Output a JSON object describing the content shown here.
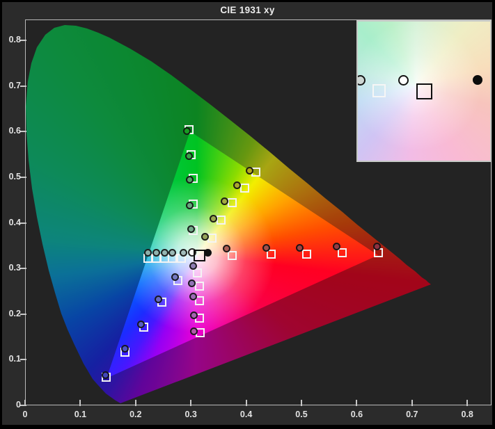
{
  "window": {
    "title": "CIE 1931 xy"
  },
  "chart_data": {
    "type": "scatter",
    "title": "CIE 1931 xy",
    "description": "CIE 1931 chromaticity horseshoe with Rec.709 gamut triangle, saturation sweep targets (white squares) and measurements (circles)",
    "xlim": [
      0,
      0.844
    ],
    "ylim": [
      0,
      0.846
    ],
    "grid": false,
    "x_ticks": [
      0,
      0.1,
      0.2,
      0.3,
      0.4,
      0.5,
      0.6,
      0.7,
      0.8
    ],
    "x_tick_labels": [
      "0",
      "0.1",
      "0.2",
      "0.3",
      "0.4",
      "0.5",
      "0.6",
      "0.7",
      "0.8"
    ],
    "y_ticks": [
      0,
      0.1,
      0.2,
      0.3,
      0.4,
      0.5,
      0.6,
      0.7,
      0.8
    ],
    "y_tick_labels": [
      "0",
      "0.1",
      "0.2",
      "0.3",
      "0.4",
      "0.5",
      "0.6",
      "0.7",
      "0.8"
    ],
    "gamut_triangle": {
      "name": "Rec. 709",
      "red": [
        0.64,
        0.33
      ],
      "green": [
        0.3,
        0.6
      ],
      "blue": [
        0.15,
        0.06
      ]
    },
    "white_point": {
      "target": [
        0.315,
        0.329
      ],
      "measured": [
        0.302,
        0.335
      ],
      "measured_fill": "#ffffff",
      "reference_dot": [
        0.331,
        0.335
      ],
      "reference_dot_fill": "#101010"
    },
    "series": [
      {
        "name": "red-saturation-sweep",
        "targets": [
          [
            0.375,
            0.329
          ],
          [
            0.445,
            0.331
          ],
          [
            0.509,
            0.331
          ],
          [
            0.574,
            0.335
          ],
          [
            0.639,
            0.335
          ]
        ],
        "measurements": [
          [
            0.365,
            0.343
          ],
          [
            0.436,
            0.346
          ],
          [
            0.497,
            0.346
          ],
          [
            0.564,
            0.348
          ],
          [
            0.637,
            0.348
          ]
        ],
        "measurement_fills": [
          "#ad5e55",
          "#a44f4b",
          "#9c4345",
          "#953a42",
          "#8f3140"
        ]
      },
      {
        "name": "green-saturation-sweep",
        "targets": [
          [
            0.304,
            0.384
          ],
          [
            0.304,
            0.442
          ],
          [
            0.304,
            0.497
          ],
          [
            0.301,
            0.55
          ],
          [
            0.297,
            0.605
          ]
        ],
        "measurements": [
          [
            0.3,
            0.387
          ],
          [
            0.298,
            0.439
          ],
          [
            0.298,
            0.494
          ],
          [
            0.296,
            0.547
          ],
          [
            0.293,
            0.602
          ]
        ],
        "measurement_fills": [
          "#74aa8a",
          "#65a87c",
          "#53a566",
          "#38a146",
          "#189c22"
        ]
      },
      {
        "name": "blue-saturation-sweep",
        "targets": [
          [
            0.276,
            0.273
          ],
          [
            0.247,
            0.227
          ],
          [
            0.215,
            0.172
          ],
          [
            0.181,
            0.117
          ],
          [
            0.147,
            0.061
          ]
        ],
        "measurements": [
          [
            0.271,
            0.282
          ],
          [
            0.241,
            0.232
          ],
          [
            0.21,
            0.178
          ],
          [
            0.181,
            0.125
          ],
          [
            0.146,
            0.067
          ]
        ],
        "measurement_fills": [
          "#7478c2",
          "#6668c4",
          "#585cc6",
          "#4e52c4",
          "#4347bb"
        ]
      },
      {
        "name": "cyan-saturation-sweep",
        "targets": [
          [
            0.222,
            0.322
          ],
          [
            0.237,
            0.322
          ],
          [
            0.252,
            0.322
          ],
          [
            0.267,
            0.322
          ],
          [
            0.283,
            0.322
          ]
        ],
        "measurements": [
          [
            0.222,
            0.335
          ],
          [
            0.237,
            0.335
          ],
          [
            0.252,
            0.335
          ],
          [
            0.267,
            0.335
          ],
          [
            0.286,
            0.335
          ]
        ],
        "measurement_fills": [
          "#8cb0aa",
          "#90b3ae",
          "#95b6b2",
          "#9bb9b6",
          "#a3bdbc"
        ]
      },
      {
        "name": "magenta-saturation-sweep",
        "targets": [
          [
            0.312,
            0.29
          ],
          [
            0.315,
            0.261
          ],
          [
            0.315,
            0.23
          ],
          [
            0.316,
            0.192
          ],
          [
            0.317,
            0.159
          ]
        ],
        "measurements": [
          [
            0.304,
            0.306
          ],
          [
            0.302,
            0.267
          ],
          [
            0.304,
            0.238
          ],
          [
            0.305,
            0.198
          ],
          [
            0.305,
            0.162
          ]
        ],
        "measurement_fills": [
          "#8d7db2",
          "#9173b6",
          "#9c6ab6",
          "#a862b2",
          "#b25aaa"
        ]
      },
      {
        "name": "yellow-saturation-sweep",
        "targets": [
          [
            0.338,
            0.366
          ],
          [
            0.355,
            0.406
          ],
          [
            0.375,
            0.444
          ],
          [
            0.397,
            0.477
          ],
          [
            0.418,
            0.511
          ]
        ],
        "measurements": [
          [
            0.325,
            0.369
          ],
          [
            0.341,
            0.41
          ],
          [
            0.361,
            0.448
          ],
          [
            0.383,
            0.483
          ],
          [
            0.406,
            0.514
          ]
        ],
        "measurement_fills": [
          "#95a35a",
          "#9aa74e",
          "#a3aa40",
          "#aaa82f",
          "#b3a81e"
        ]
      }
    ]
  },
  "inset": {
    "name": "white-point-zoom",
    "points": [
      {
        "type": "circle",
        "x": 3,
        "y": 84,
        "size": 15,
        "fill": "#cdd6d3",
        "stroke": "#141414"
      },
      {
        "type": "square",
        "x": 30,
        "y": 99,
        "size": 19,
        "stroke": "#f6f6f6"
      },
      {
        "type": "circle",
        "x": 65,
        "y": 84,
        "size": 15,
        "fill": "#ffffff",
        "stroke": "#141414"
      },
      {
        "type": "square",
        "x": 95,
        "y": 100,
        "size": 23,
        "stroke": "#0e0e0e"
      },
      {
        "type": "circle",
        "x": 172,
        "y": 84,
        "size": 14,
        "fill": "#0c0c0c",
        "stroke": "#0c0c0c"
      }
    ]
  },
  "colors": {
    "background": "#2b2b2b",
    "plot_background": "#232323",
    "axis": "#c8c8c8",
    "target_marker": "#f4f4f4",
    "white_point_marker": "#0e0e0e"
  }
}
